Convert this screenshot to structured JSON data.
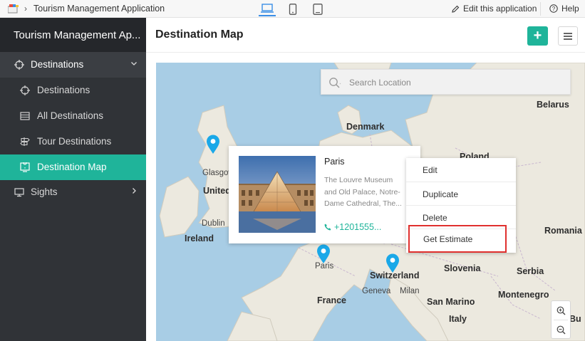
{
  "topbar": {
    "app_name": "Tourism Management Application",
    "breadcrumb_sep": "›",
    "edit_label": "Edit this application",
    "help_label": "Help"
  },
  "sidebar": {
    "title": "Tourism Management Ap...",
    "items": [
      {
        "label": "Destinations"
      },
      {
        "label": "Destinations"
      },
      {
        "label": "All Destinations"
      },
      {
        "label": "Tour Destinations"
      },
      {
        "label": "Destination Map"
      },
      {
        "label": "Sights"
      }
    ]
  },
  "main": {
    "title": "Destination Map",
    "add_label": "+"
  },
  "map": {
    "search_placeholder": "Search Location",
    "labels": {
      "belarus": "Belarus",
      "denmark": "Denmark",
      "poland": "Poland",
      "glasgow": "Glasgow",
      "united": "United",
      "dublin": "Dublin",
      "ireland": "Ireland",
      "romania": "Romania",
      "paris": "Paris",
      "switzerland": "Switzerland",
      "slovenia": "Slovenia",
      "serbia": "Serbia",
      "geneva": "Geneva",
      "milan": "Milan",
      "montenegro": "Montenegro",
      "france": "France",
      "san_marino": "San Marino",
      "italy": "Italy",
      "bulgaria": "Bu"
    }
  },
  "info_card": {
    "name": "Paris",
    "description": "The Louvre Museum and Old Palace, Notre-Dame Cathedral, The...",
    "phone": "+1201555..."
  },
  "context_menu": {
    "items": [
      "Edit",
      "Duplicate",
      "Delete",
      "Get Estimate"
    ]
  },
  "colors": {
    "accent": "#1fb49a",
    "sidebar_bg": "#303337",
    "highlight_border": "#e0302e",
    "pin": "#1aa8e8"
  }
}
